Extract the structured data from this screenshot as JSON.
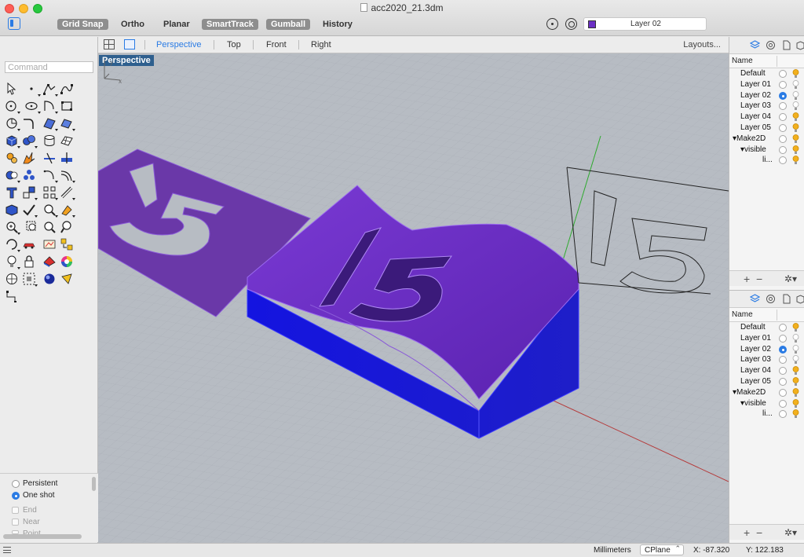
{
  "window": {
    "title": "acc2020_21.3dm"
  },
  "toolbar": {
    "grid_snap": "Grid Snap",
    "ortho": "Ortho",
    "planar": "Planar",
    "smarttrack": "SmartTrack",
    "gumball": "Gumball",
    "history": "History",
    "current_layer": "Layer 02",
    "current_layer_color": "#6b2fc4"
  },
  "viewport_tabs": {
    "perspective": "Perspective",
    "top": "Top",
    "front": "Front",
    "right": "Right",
    "layouts": "Layouts..."
  },
  "command": {
    "placeholder": "Command"
  },
  "viewport": {
    "label": "Perspective",
    "axis_y": "y",
    "axis_x": "x",
    "model_text": "15"
  },
  "osnap": {
    "persistent": "Persistent",
    "one_shot": "One shot",
    "end": "End",
    "near": "Near",
    "point": "Point"
  },
  "layers_panel": {
    "header": "Name",
    "rows": [
      {
        "name": "Default",
        "current": false,
        "indent": 0
      },
      {
        "name": "Layer 01",
        "current": false,
        "indent": 0
      },
      {
        "name": "Layer 02",
        "current": true,
        "indent": 0
      },
      {
        "name": "Layer 03",
        "current": false,
        "indent": 0
      },
      {
        "name": "Layer 04",
        "current": false,
        "indent": 0
      },
      {
        "name": "Layer 05",
        "current": false,
        "indent": 0
      },
      {
        "name": "▾Make2D",
        "current": false,
        "indent": 0
      },
      {
        "name": "▾visible",
        "current": false,
        "indent": 1
      },
      {
        "name": "li...",
        "current": false,
        "indent": 2
      }
    ]
  },
  "statusbar": {
    "units": "Millimeters",
    "cplane": "CPlane",
    "x": "X: -87.320",
    "y": "Y: 122.183"
  },
  "colors": {
    "accent": "#2a7be4",
    "model_purple": "#6b2fc4",
    "model_blue": "#1a1ad6",
    "viewport_bg": "#b5bac1"
  }
}
